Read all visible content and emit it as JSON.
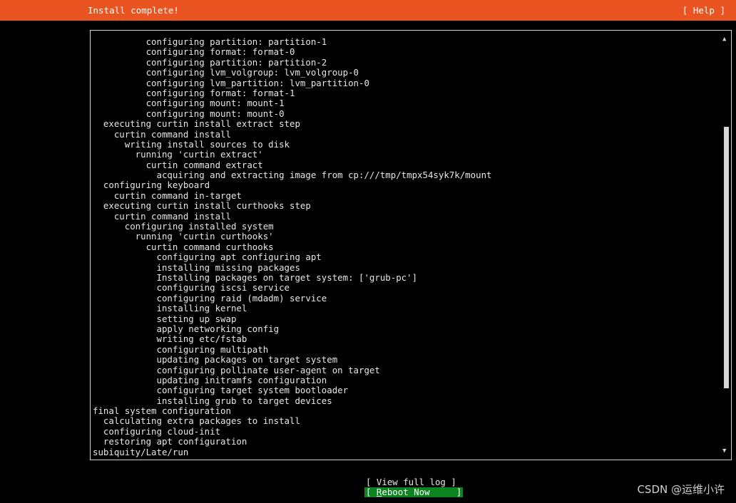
{
  "header": {
    "title": "Install complete!",
    "help_label": "[ Help ]",
    "color": "#e95420"
  },
  "log": {
    "lines": [
      "          configuring partition: partition-1",
      "          configuring format: format-0",
      "          configuring partition: partition-2",
      "          configuring lvm_volgroup: lvm_volgroup-0",
      "          configuring lvm_partition: lvm_partition-0",
      "          configuring format: format-1",
      "          configuring mount: mount-1",
      "          configuring mount: mount-0",
      "  executing curtin install extract step",
      "    curtin command install",
      "      writing install sources to disk",
      "        running 'curtin extract'",
      "          curtin command extract",
      "            acquiring and extracting image from cp:///tmp/tmpx54syk7k/mount",
      "  configuring keyboard",
      "    curtin command in-target",
      "  executing curtin install curthooks step",
      "    curtin command install",
      "      configuring installed system",
      "        running 'curtin curthooks'",
      "          curtin command curthooks",
      "            configuring apt configuring apt",
      "            installing missing packages",
      "            Installing packages on target system: ['grub-pc']",
      "            configuring iscsi service",
      "            configuring raid (mdadm) service",
      "            installing kernel",
      "            setting up swap",
      "            apply networking config",
      "            writing etc/fstab",
      "            configuring multipath",
      "            updating packages on target system",
      "            configuring pollinate user-agent on target",
      "            updating initramfs configuration",
      "            configuring target system bootloader",
      "            installing grub to target devices",
      "final system configuration",
      "  calculating extra packages to install",
      "  configuring cloud-init",
      "  restoring apt configuration",
      "subiquity/Late/run"
    ],
    "scroll_position": 0.37
  },
  "scrollbar": {
    "up_icon": "▲",
    "down_icon": "▼"
  },
  "actions": {
    "view_log_label": "[ View full log ]",
    "reboot_open": "[ ",
    "reboot_hotkey": "R",
    "reboot_rest": "eboot Now     ]",
    "reboot_color": "#0e8420"
  },
  "watermark": {
    "text": "CSDN @运维小许"
  }
}
